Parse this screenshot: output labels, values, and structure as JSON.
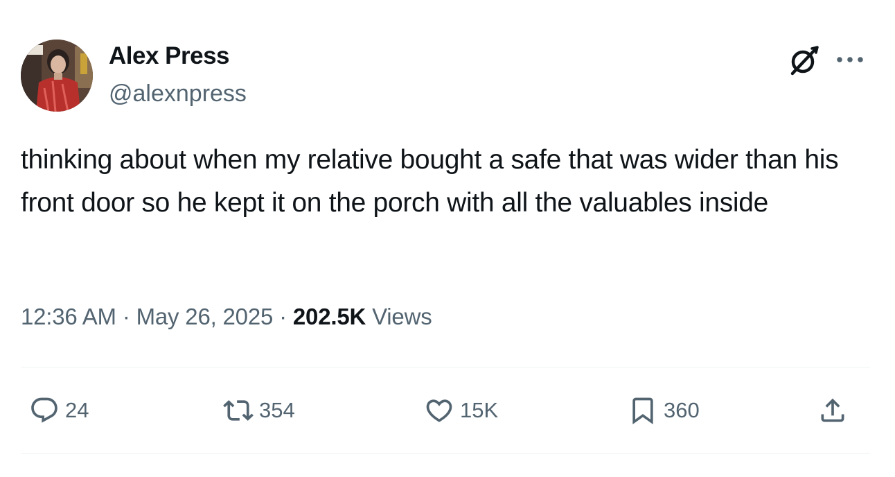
{
  "user": {
    "name": "Alex Press",
    "handle": "@alexnpress"
  },
  "tweet": {
    "text": "thinking about when my relative bought a safe that was wider than his front door so he kept it on the porch with all the valuables inside",
    "time": "12:36 AM",
    "separator": "·",
    "date": "May 26, 2025",
    "views_count": "202.5K",
    "views_label": "Views"
  },
  "actions": {
    "replies": "24",
    "reposts": "354",
    "likes": "15K",
    "bookmarks": "360"
  },
  "icons": {
    "header": [
      "grok-icon",
      "more-icon"
    ],
    "actions": [
      "reply-icon",
      "repost-icon",
      "like-icon",
      "bookmark-icon",
      "share-icon"
    ]
  },
  "colors": {
    "text": "#0f1419",
    "secondary": "#536471",
    "divider": "#eff3f4"
  }
}
